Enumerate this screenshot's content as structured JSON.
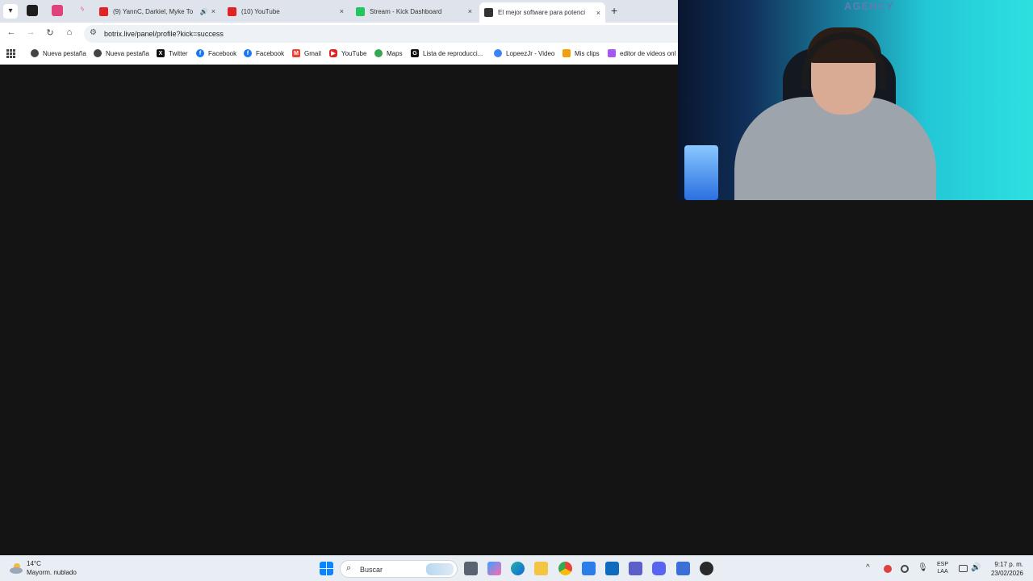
{
  "browser": {
    "tabs": [
      {
        "title": "(9) YannC, Darkiel, Myke To",
        "favicon_color": "#e02424",
        "has_audio": true
      },
      {
        "title": "(10) YouTube",
        "favicon_color": "#e02424",
        "has_audio": false
      },
      {
        "title": "Stream - Kick Dashboard",
        "favicon_color": "#22c55e",
        "has_audio": false
      },
      {
        "title": "El mejor software para potenci",
        "favicon_color": "#333333",
        "has_audio": false
      }
    ],
    "close_glyph": "×",
    "audio_glyph": "🔊",
    "new_tab_glyph": "+",
    "nav": {
      "back": "←",
      "forward": "→",
      "reload": "↻",
      "home": "⌂"
    },
    "address": {
      "url": "botrix.live/panel/profile?kick=success",
      "site_icon": "⚙"
    },
    "bookmarks": [
      {
        "label": "Nueva pestaña",
        "icon": "globe-icon",
        "color": "#444444"
      },
      {
        "label": "Nueva pestaña",
        "icon": "chrome-icon",
        "color": "#444444"
      },
      {
        "label": "Twitter",
        "icon": "x-icon",
        "color": "#111111"
      },
      {
        "label": "Facebook",
        "icon": "facebook-icon",
        "color": "#1877f2"
      },
      {
        "label": "Facebook",
        "icon": "facebook-icon",
        "color": "#1877f2"
      },
      {
        "label": "Gmail",
        "icon": "gmail-icon",
        "color": "#ea4335"
      },
      {
        "label": "YouTube",
        "icon": "youtube-icon",
        "color": "#e02424"
      },
      {
        "label": "Maps",
        "icon": "maps-icon",
        "color": "#34a853"
      },
      {
        "label": "Lista de reproducci...",
        "icon": "list-icon",
        "color": "#111111"
      },
      {
        "label": "LopeezJr - Video",
        "icon": "video-icon",
        "color": "#3b82f6"
      },
      {
        "label": "Mis clips",
        "icon": "clips-icon",
        "color": "#f59e0b"
      },
      {
        "label": "editor de videos onl",
        "icon": "editor-icon",
        "color": "#a855f7"
      }
    ]
  },
  "webcam": {
    "sign_text": "AGENCY"
  },
  "taskbar": {
    "weather": {
      "temp": "14°C",
      "desc": "Mayorm. nublado"
    },
    "search_placeholder": "Buscar",
    "lang_line1": "ESP",
    "lang_line2": "LAA",
    "time": "9:17 p. m.",
    "date": "23/02/2026",
    "tray": {
      "chevron": "^",
      "mic": "🎙",
      "volume": "🔊"
    }
  }
}
